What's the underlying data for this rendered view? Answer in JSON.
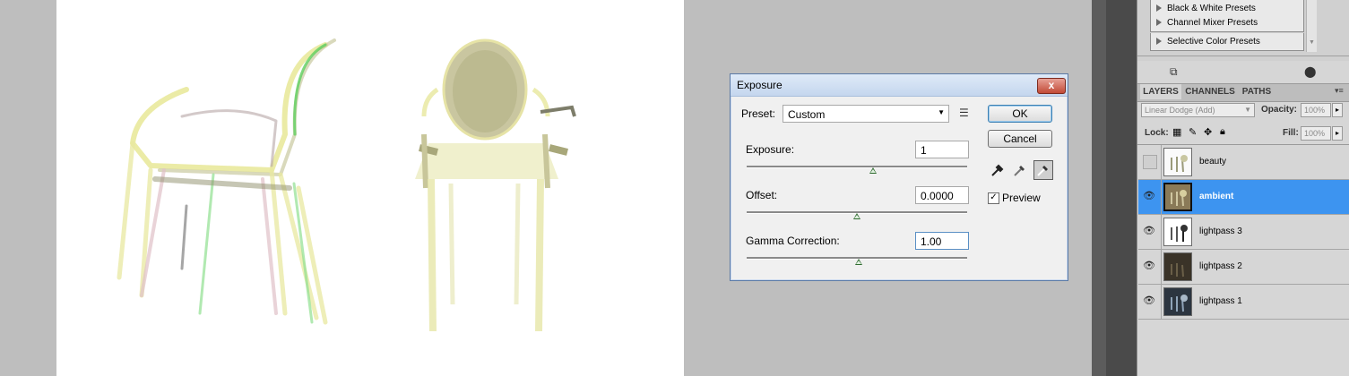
{
  "dialog": {
    "title": "Exposure",
    "close_label": "x",
    "preset_label": "Preset:",
    "preset_value": "Custom",
    "ok_label": "OK",
    "cancel_label": "Cancel",
    "exposure_label": "Exposure:",
    "exposure_value": "1",
    "offset_label": "Offset:",
    "offset_value": "0.0000",
    "gamma_label": "Gamma Correction:",
    "gamma_value": "1.00",
    "preview_label": "Preview",
    "preview_checked": true
  },
  "presets_list": {
    "items": [
      "Black & White Presets",
      "Channel Mixer Presets",
      "Selective Color Presets"
    ]
  },
  "layers_panel": {
    "tabs": [
      "LAYERS",
      "CHANNELS",
      "PATHS"
    ],
    "blend_mode": "Linear Dodge (Add)",
    "opacity_label": "Opacity:",
    "opacity_value": "100%",
    "lock_label": "Lock:",
    "fill_label": "Fill:",
    "fill_value": "100%",
    "layers": [
      {
        "name": "beauty",
        "visible": false,
        "selected": false
      },
      {
        "name": "ambient",
        "visible": true,
        "selected": true
      },
      {
        "name": "lightpass 3",
        "visible": true,
        "selected": false
      },
      {
        "name": "lightpass 2",
        "visible": true,
        "selected": false
      },
      {
        "name": "lightpass 1",
        "visible": true,
        "selected": false
      }
    ]
  },
  "colors": {
    "selection": "#3d94f0",
    "canvas_bg": "#bebebe"
  }
}
